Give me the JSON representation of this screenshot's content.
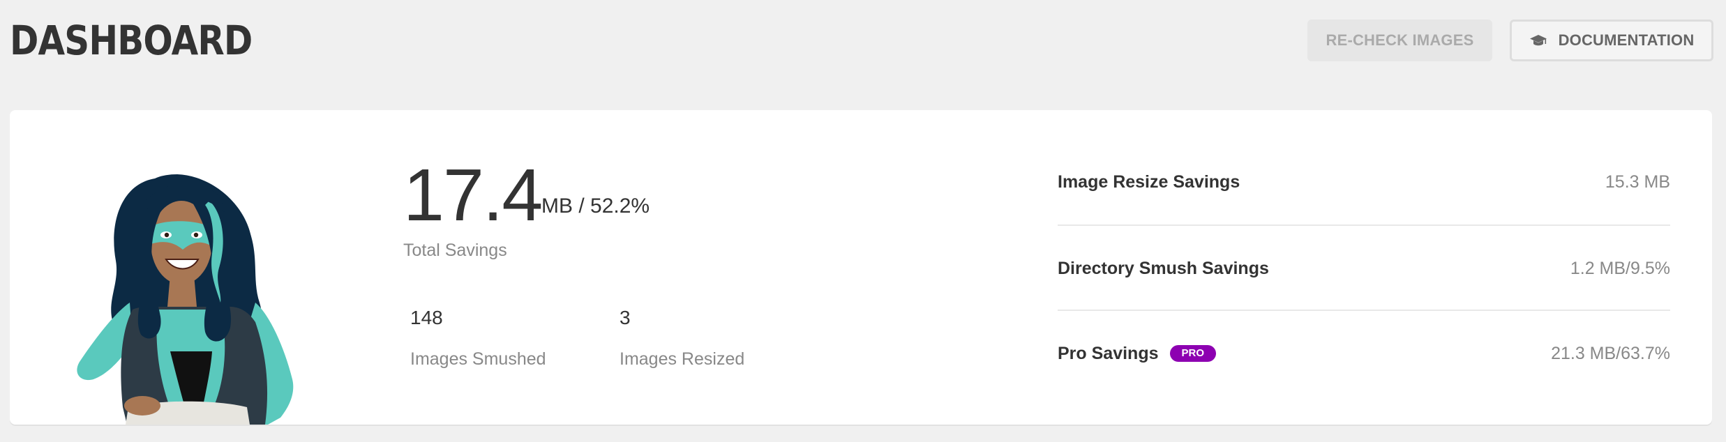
{
  "header": {
    "title": "DASHBOARD",
    "recheck_label": "RE-CHECK IMAGES",
    "docs_label": "DOCUMENTATION",
    "docs_icon": "graduation-cap-icon"
  },
  "summary": {
    "total_value": "17.4",
    "total_unit": "MB / 52.2%",
    "total_label": "Total Savings",
    "smushed_count": "148",
    "smushed_label": "Images Smushed",
    "resized_count": "3",
    "resized_label": "Images Resized"
  },
  "savings": [
    {
      "label": "Image Resize Savings",
      "value": "15.3 MB"
    },
    {
      "label": "Directory Smush Savings",
      "value": "1.2 MB/9.5%"
    },
    {
      "label": "Pro Savings",
      "badge": "PRO",
      "value": "21.3 MB/63.7%"
    }
  ],
  "colors": {
    "background": "#f0f0f0",
    "card": "#ffffff",
    "pro_badge": "#8d00b1",
    "mascot_teal": "#5ac9bd",
    "mascot_hair": "#0c2a44"
  }
}
